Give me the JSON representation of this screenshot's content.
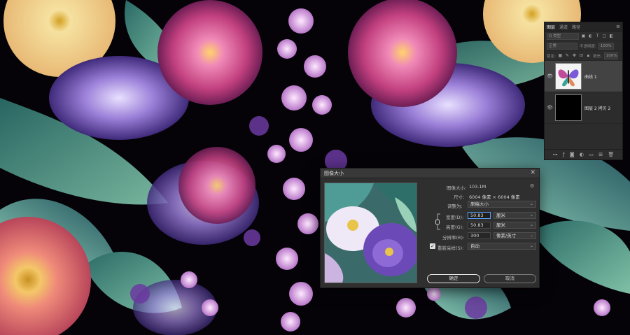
{
  "layers_panel": {
    "tabs": [
      "图层",
      "通道",
      "路径"
    ],
    "active_tab": 0,
    "menu_icon": "panel-menu-icon",
    "filter_placeholder": "Q 类型",
    "blend_mode": "正常",
    "opacity_label": "不透明度:",
    "opacity_value": "100%",
    "lock_label": "锁定:",
    "fill_label": "填充:",
    "fill_value": "100%",
    "layers": [
      {
        "name": "曲线 1",
        "selected": true,
        "visible": true
      },
      {
        "name": "图层 2 拷贝 2",
        "selected": false,
        "visible": true
      }
    ]
  },
  "dialog": {
    "title": "图像大小",
    "image_size_label": "图像大小:",
    "image_size_value": "103.1M",
    "dimensions_label": "尺寸:",
    "dimensions_value": "6004 像素 × 6004 像素",
    "fit_label": "调整为:",
    "fit_value": "原稿大小",
    "width_label": "宽度(D):",
    "width_value": "50.83",
    "width_unit": "厘米",
    "height_label": "高度(G):",
    "height_value": "50.83",
    "height_unit": "厘米",
    "resolution_label": "分辨率(R):",
    "resolution_value": "300",
    "resolution_unit": "像素/英寸",
    "resample_label": "重新采样(S):",
    "resample_value": "自动",
    "resample_checked": true,
    "ok_label": "确定",
    "cancel_label": "取消"
  }
}
